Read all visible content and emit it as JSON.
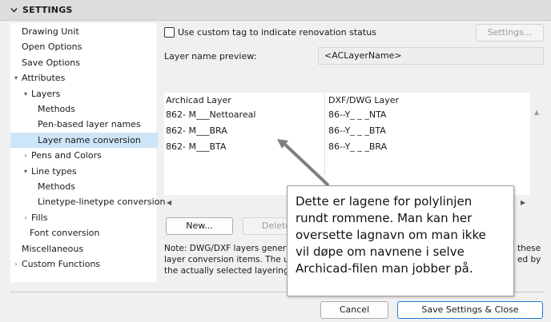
{
  "header": {
    "title": "SETTINGS"
  },
  "tree": {
    "items": [
      {
        "label": "Drawing Unit",
        "twisty": ""
      },
      {
        "label": "Open Options",
        "twisty": ""
      },
      {
        "label": "Save Options",
        "twisty": ""
      },
      {
        "label": "Attributes",
        "twisty": "expanded"
      },
      {
        "label": "Layers",
        "twisty": "expanded"
      },
      {
        "label": "Methods",
        "twisty": ""
      },
      {
        "label": "Pen-based layer names",
        "twisty": ""
      },
      {
        "label": "Layer name conversion",
        "twisty": "",
        "selected": true
      },
      {
        "label": "Pens and Colors",
        "twisty": "collapsed"
      },
      {
        "label": "Line types",
        "twisty": "expanded"
      },
      {
        "label": "Methods",
        "twisty": ""
      },
      {
        "label": "Linetype-linetype conversion",
        "twisty": ""
      },
      {
        "label": "Fills",
        "twisty": "collapsed"
      },
      {
        "label": "Font conversion",
        "twisty": ""
      },
      {
        "label": "Miscellaneous",
        "twisty": ""
      },
      {
        "label": "Custom Functions",
        "twisty": "collapsed"
      }
    ]
  },
  "options": {
    "custom_tag_label": "Use custom tag to indicate renovation status",
    "custom_tag_checked": false,
    "settings_button": "Settings..."
  },
  "preview": {
    "label": "Layer name preview:",
    "value": "<ACLayerName>"
  },
  "table": {
    "headers": [
      "Archicad Layer",
      "DXF/DWG Layer"
    ],
    "rows": [
      [
        "862- M___Nettoareal",
        "86--Y_ _ _NTA"
      ],
      [
        "862- M___BRA",
        "86--Y_ _ _BTA"
      ],
      [
        "862- M___BTA",
        "86--Y_ _ _BRA"
      ]
    ]
  },
  "buttons": {
    "new": "New...",
    "delete": "Delete"
  },
  "note": {
    "lines": [
      "Note: DWG/DXF layers generat",
      "layer conversion items. The upp",
      "the actually selected layering m"
    ],
    "right_fragments": [
      "these",
      "ed by"
    ]
  },
  "footer": {
    "cancel": "Cancel",
    "save_close": "Save Settings & Close"
  },
  "callout": {
    "lines": [
      "Dette er lagene for polylinjen",
      "rundt rommene. Man kan her",
      "oversette lagnavn om man ikke",
      "vil døpe om navnene i selve",
      "Archicad-filen man jobber på."
    ]
  },
  "colors": {
    "selection": "#cde5f8",
    "primary_border": "#1e78d2",
    "header_bg": "#dddddd"
  }
}
